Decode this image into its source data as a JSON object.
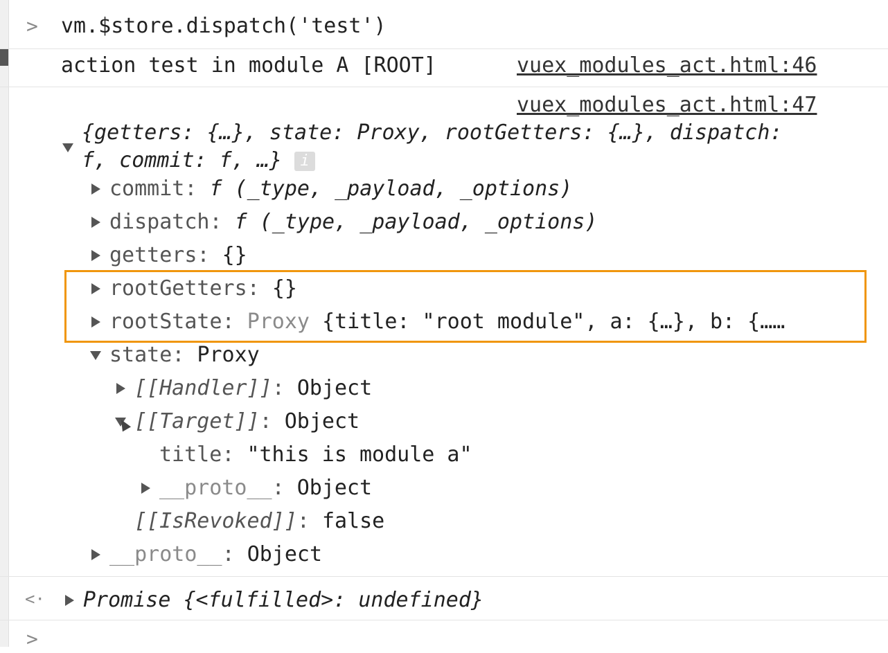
{
  "console": {
    "input_command": "vm.$store.dispatch('test')",
    "log1_text": "action test in module A [ROOT]",
    "log1_source": "vuex_modules_act.html:46",
    "log2_source": "vuex_modules_act.html:47",
    "object_summary_line1": "{getters: {…}, state: Proxy, rootGetters: {…}, dispatch:",
    "object_summary_line2": "f, commit: f, …}",
    "info_badge": "i",
    "props": {
      "commit_key": "commit",
      "commit_value": "f (_type, _payload, _options)",
      "dispatch_key": "dispatch",
      "dispatch_value": "f (_type, _payload, _options)",
      "getters_key": "getters",
      "getters_value": "{}",
      "rootGetters_key": "rootGetters",
      "rootGetters_value": "{}",
      "rootState_key": "rootState",
      "rootState_proxy": "Proxy",
      "rootState_value": "{title: \"root module\", a: {…}, b: {……",
      "state_key": "state",
      "state_value": "Proxy",
      "handler_key": "[[Handler]]",
      "handler_value": "Object",
      "target_key": "[[Target]]",
      "target_value": "Object",
      "title_key": "title",
      "title_value": "\"this is module a\"",
      "proto_inner_key": "__proto__",
      "proto_inner_value": "Object",
      "isrevoked_key": "[[IsRevoked]]",
      "isrevoked_value": "false",
      "proto_outer_key": "__proto__",
      "proto_outer_value": "Object"
    },
    "result_text": "Promise {<fulfilled>: undefined}",
    "prompt_symbol": ">",
    "return_symbol": "<·"
  },
  "colors": {
    "highlight": "#f0960e"
  }
}
